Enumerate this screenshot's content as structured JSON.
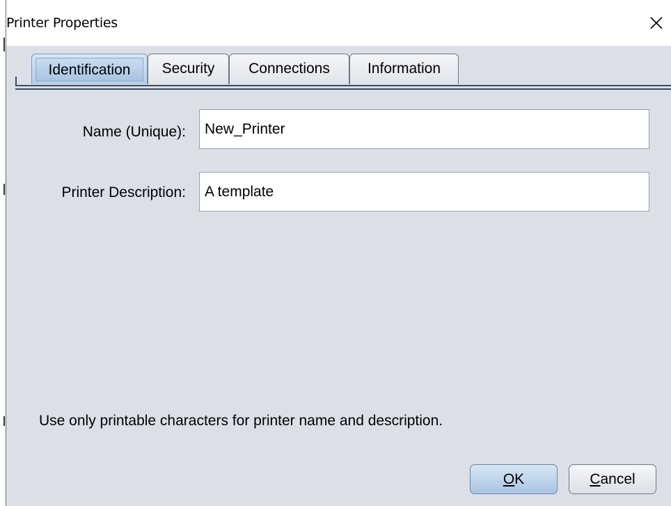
{
  "window": {
    "title": "Printer Properties",
    "close_icon": "close-icon"
  },
  "tabs": [
    {
      "label": "Identification",
      "active": true
    },
    {
      "label": "Security",
      "active": false
    },
    {
      "label": "Connections",
      "active": false
    },
    {
      "label": "Information",
      "active": false
    }
  ],
  "form": {
    "name_label": "Name (Unique):",
    "name_value": "New_Printer",
    "description_label": "Printer Description:",
    "description_value": "A template"
  },
  "hint": "Use only printable characters for printer name and description.",
  "buttons": {
    "ok": {
      "mnemonic": "O",
      "rest": "K"
    },
    "cancel": {
      "mnemonic": "C",
      "rest": "ancel"
    }
  },
  "colors": {
    "dialog_background": "#dcdfe6",
    "active_tab": "#b4cde6",
    "default_button": "#a9c4e2"
  }
}
